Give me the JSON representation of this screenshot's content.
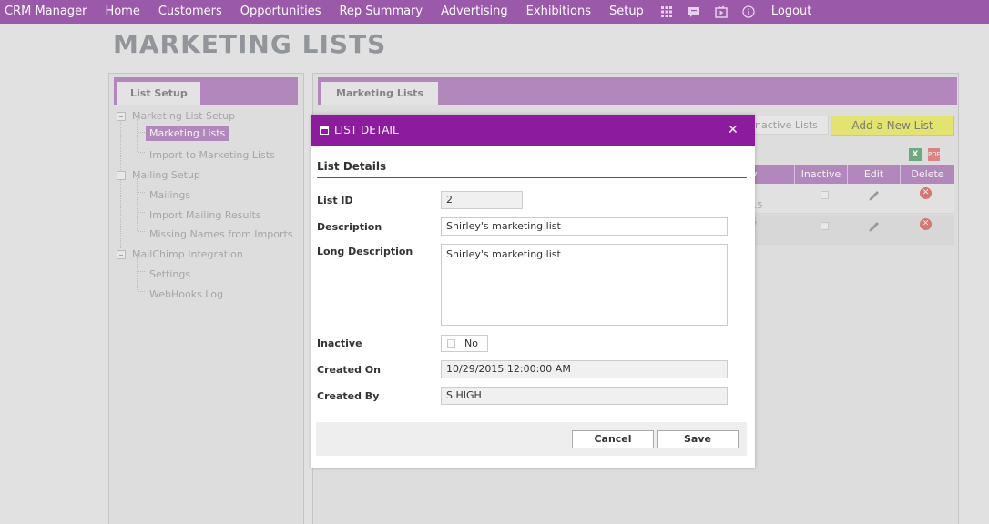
{
  "nav": {
    "brand": "CRM Manager",
    "items": [
      "Home",
      "Customers",
      "Opportunities",
      "Rep Summary",
      "Advertising",
      "Exhibitions",
      "Setup"
    ],
    "icons": [
      "grid-icon",
      "chat-icon",
      "video-icon",
      "info-icon"
    ],
    "logout": "Logout"
  },
  "page_title": "MARKETING LISTS",
  "left_panel": {
    "tab": "List Setup",
    "tree": {
      "group1": "Marketing List Setup",
      "g1_items": [
        "Marketing Lists",
        "Import to Marketing Lists"
      ],
      "group2": "Mailing Setup",
      "g2_items": [
        "Mailings",
        "Import Mailing Results",
        "Missing Names from Imports"
      ],
      "group3": "MailChimp Integration",
      "g3_items": [
        "Settings",
        "WebHooks Log"
      ]
    }
  },
  "right_panel": {
    "tab": "Marketing Lists",
    "inactive_lists_btn": "nactive Lists",
    "add_list_btn": "Add a New List",
    "export_icons": [
      "excel-icon",
      "pdf-icon"
    ],
    "grid": {
      "headers": [
        "y",
        "Inactive",
        "Edit",
        "Delete"
      ],
      "rows": [
        {
          "partial": "15"
        },
        {
          "partial": "5"
        }
      ]
    }
  },
  "modal": {
    "title": "LIST DETAIL",
    "section": "List Details",
    "labels": {
      "list_id": "List ID",
      "description": "Description",
      "long_description": "Long Description",
      "inactive": "Inactive",
      "created_on": "Created On",
      "created_by": "Created By"
    },
    "values": {
      "list_id": "2",
      "description": "Shirley's marketing list",
      "long_description": "Shirley's marketing list",
      "inactive": "No",
      "created_on": "10/29/2015 12:00:00 AM",
      "created_by": "S.HIGH"
    },
    "cancel": "Cancel",
    "save": "Save"
  },
  "colors": {
    "nav_bg": "#9b59a9",
    "modal_header": "#8c1b9d",
    "add_button": "#e7e736",
    "delete_icon": "#d43c3c",
    "excel": "#2f8f4e"
  }
}
